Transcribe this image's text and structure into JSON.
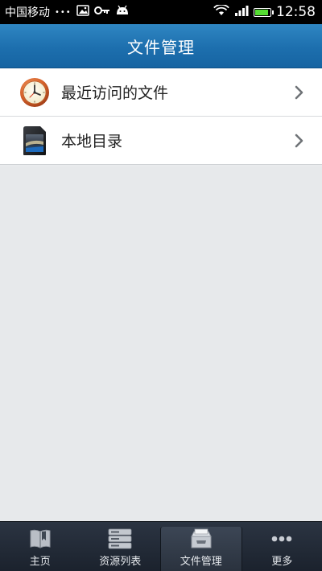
{
  "status_bar": {
    "carrier": "中国移动",
    "dots": "•••",
    "time": "12:58",
    "battery_level": 0.95,
    "battery_color": "#55dd33"
  },
  "header": {
    "title": "文件管理",
    "background_color": "#1d6fae"
  },
  "list": {
    "items": [
      {
        "label": "最近访问的文件",
        "icon": "clock-icon"
      },
      {
        "label": "本地目录",
        "icon": "sd-card-icon"
      }
    ]
  },
  "bottom_nav": {
    "active_index": 2,
    "items": [
      {
        "label": "主页",
        "icon": "home-book-icon"
      },
      {
        "label": "资源列表",
        "icon": "server-list-icon"
      },
      {
        "label": "文件管理",
        "icon": "file-tray-icon"
      },
      {
        "label": "更多",
        "icon": "more-dots-icon"
      }
    ]
  }
}
